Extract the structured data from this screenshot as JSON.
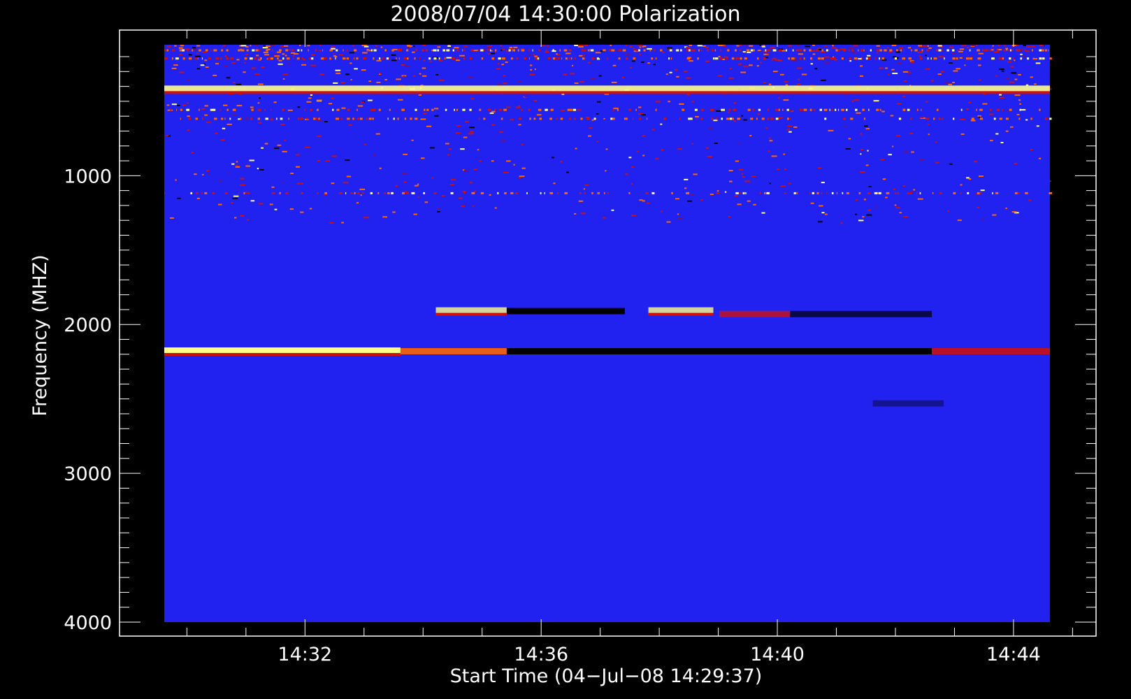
{
  "chart_data": {
    "type": "heatmap",
    "title": "2008/07/04 14:30:00 Polarization",
    "xlabel": "Start Time (04−Jul−08 14:29:37)",
    "ylabel": "Frequency (MHZ)",
    "x_ticks": [
      "14:32",
      "14:36",
      "14:40",
      "14:44"
    ],
    "y_ticks": [
      "1000",
      "2000",
      "3000",
      "4000"
    ],
    "x_range_minutes": [
      0,
      15
    ],
    "y_range_mhz": [
      120,
      4000
    ],
    "y_inverted": true,
    "grid": false,
    "colors": {
      "background": "#000000",
      "axis": "#ffffff",
      "base": "#2222f0",
      "hot": "#ffff88",
      "warm": "#ff6600",
      "red": "#cc1010",
      "cold": "#000000"
    },
    "bands": [
      {
        "y_mhz": 160,
        "x_start": 0,
        "x_end": 15,
        "kind": "noisy",
        "intensity": 0.9
      },
      {
        "y_mhz": 215,
        "x_start": 0,
        "x_end": 15,
        "kind": "noisy",
        "intensity": 0.8
      },
      {
        "y_mhz": 420,
        "x_start": 0,
        "x_end": 15,
        "kind": "hot",
        "intensity": 0.9
      },
      {
        "y_mhz": 560,
        "x_start": 0,
        "x_end": 15,
        "kind": "noisy",
        "intensity": 0.5
      },
      {
        "y_mhz": 620,
        "x_start": 0,
        "x_end": 15,
        "kind": "noisy",
        "intensity": 0.5
      },
      {
        "y_mhz": 1120,
        "x_start": 0,
        "x_end": 15,
        "kind": "noisy",
        "intensity": 0.6
      },
      {
        "y_mhz": 1910,
        "x_start": 4.6,
        "x_end": 5.8,
        "kind": "hot",
        "intensity": 0.8
      },
      {
        "y_mhz": 1910,
        "x_start": 5.8,
        "x_end": 7.8,
        "kind": "cold",
        "intensity": 1.0
      },
      {
        "y_mhz": 1910,
        "x_start": 8.2,
        "x_end": 9.3,
        "kind": "hot",
        "intensity": 0.8
      },
      {
        "y_mhz": 1930,
        "x_start": 9.4,
        "x_end": 10.6,
        "kind": "red",
        "intensity": 0.8
      },
      {
        "y_mhz": 1930,
        "x_start": 10.6,
        "x_end": 13.0,
        "kind": "cold",
        "intensity": 0.7
      },
      {
        "y_mhz": 2180,
        "x_start": 0,
        "x_end": 4.0,
        "kind": "hot",
        "intensity": 1.0
      },
      {
        "y_mhz": 2180,
        "x_start": 4.0,
        "x_end": 5.8,
        "kind": "warm",
        "intensity": 0.9
      },
      {
        "y_mhz": 2180,
        "x_start": 5.8,
        "x_end": 13.0,
        "kind": "cold",
        "intensity": 1.0
      },
      {
        "y_mhz": 2180,
        "x_start": 13.0,
        "x_end": 15,
        "kind": "red",
        "intensity": 0.9
      },
      {
        "y_mhz": 2530,
        "x_start": 12.0,
        "x_end": 13.2,
        "kind": "cold",
        "intensity": 0.4
      }
    ]
  }
}
